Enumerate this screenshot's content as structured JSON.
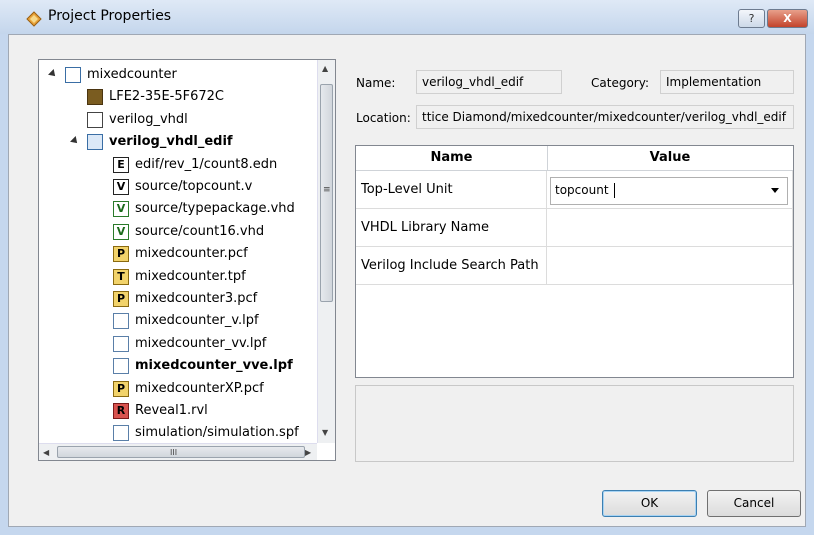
{
  "window": {
    "title": "Project Properties",
    "help_label": "?",
    "close_label": "X"
  },
  "tree": {
    "items": [
      {
        "label": "mixedcounter",
        "level": 0,
        "expanded": true,
        "bold": false,
        "icon": "project-icon"
      },
      {
        "label": "LFE2-35E-5F672C",
        "level": 1,
        "bold": false,
        "icon": "device-icon"
      },
      {
        "label": "verilog_vhdl",
        "level": 1,
        "bold": false,
        "icon": "implementation-icon"
      },
      {
        "label": "verilog_vhdl_edif",
        "level": 1,
        "expanded": true,
        "bold": true,
        "icon": "active-implementation-icon"
      },
      {
        "label": "edif/rev_1/count8.edn",
        "level": 2,
        "bold": false,
        "icon": "edif-icon"
      },
      {
        "label": "source/topcount.v",
        "level": 2,
        "bold": false,
        "icon": "verilog-icon"
      },
      {
        "label": "source/typepackage.vhd",
        "level": 2,
        "bold": false,
        "icon": "vhdl-icon"
      },
      {
        "label": "source/count16.vhd",
        "level": 2,
        "bold": false,
        "icon": "vhdl-icon"
      },
      {
        "label": "mixedcounter.pcf",
        "level": 2,
        "bold": false,
        "icon": "pcf-icon"
      },
      {
        "label": "mixedcounter.tpf",
        "level": 2,
        "bold": false,
        "icon": "tpf-icon"
      },
      {
        "label": "mixedcounter3.pcf",
        "level": 2,
        "bold": false,
        "icon": "pcf-icon"
      },
      {
        "label": "mixedcounter_v.lpf",
        "level": 2,
        "bold": false,
        "icon": "lpf-icon"
      },
      {
        "label": "mixedcounter_vv.lpf",
        "level": 2,
        "bold": false,
        "icon": "lpf-icon"
      },
      {
        "label": "mixedcounter_vve.lpf",
        "level": 2,
        "bold": true,
        "icon": "lpf-icon"
      },
      {
        "label": "mixedcounterXP.pcf",
        "level": 2,
        "bold": false,
        "icon": "pcf-icon"
      },
      {
        "label": "Reveal1.rvl",
        "level": 2,
        "bold": false,
        "icon": "reveal-icon"
      },
      {
        "label": "simulation/simulation.spf",
        "level": 2,
        "bold": false,
        "icon": "spf-icon"
      }
    ]
  },
  "fields": {
    "name_label": "Name:",
    "name_value": "verilog_vhdl_edif",
    "category_label": "Category:",
    "category_value": "Implementation",
    "location_label": "Location:",
    "location_value": "ttice Diamond/mixedcounter/mixedcounter/verilog_vhdl_edif"
  },
  "grid": {
    "headers": [
      "Name",
      "Value"
    ],
    "rows": [
      {
        "name": "Top-Level Unit",
        "value": "topcount",
        "dropdown": true
      },
      {
        "name": "VHDL Library Name",
        "value": ""
      },
      {
        "name": "Verilog Include Search Path",
        "value": ""
      }
    ]
  },
  "buttons": {
    "ok": "OK",
    "cancel": "Cancel"
  },
  "scroll": {
    "h_arrow_left": "◀",
    "h_arrow_right": "▶",
    "v_arrow_up": "▲",
    "v_arrow_down": "▼",
    "h_grip": "III",
    "v_grip": "≡"
  },
  "colors": {
    "title_bar": "#c4d6ec",
    "close_button": "#c3432b",
    "selection_bold": "#000000"
  }
}
